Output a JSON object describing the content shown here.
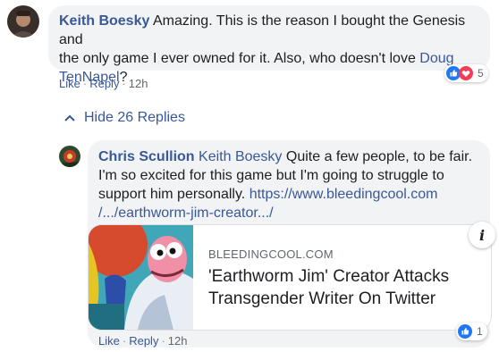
{
  "comment1": {
    "author": "Keith Boesky",
    "text_1": "Amazing. This is the reason I bought the Genesis and",
    "text_2": "the only game I ever owned for it. Also, who doesn't love",
    "link_1": "Doug",
    "link_2": "TenNapel",
    "text_end": "?",
    "like_label": "Like",
    "reply_label": "Reply",
    "time": "12h",
    "reaction_icons": [
      "like-icon",
      "love-icon"
    ],
    "reaction_count": "5"
  },
  "replies": {
    "hide_label": "Hide 26 Replies"
  },
  "comment2": {
    "author": "Chris Scullion",
    "mention": "Keith Boesky",
    "text_1": "Quite a few people, to be fair.",
    "text_2": "I'm so excited for this game but I'm going to struggle to",
    "text_3": "support him personally.",
    "url_1": "https://www.bleedingcool.com",
    "url_2": "/.../earthworm-jim-creator.../",
    "card_domain": "BLEEDINGCOOL.COM",
    "card_title_1": "'Earthworm Jim' Creator Attacks",
    "card_title_2": "Transgender Writer On Twitter",
    "info_glyph": "i",
    "like_label": "Like",
    "reply_label": "Reply",
    "time": "12h",
    "reaction_icons": [
      "like-icon"
    ],
    "reaction_count": "1"
  },
  "colors": {
    "link": "#385898",
    "bubble": "#f2f3f5",
    "meta": "#606770",
    "like": "#2078f4",
    "love": "#f33e58"
  }
}
